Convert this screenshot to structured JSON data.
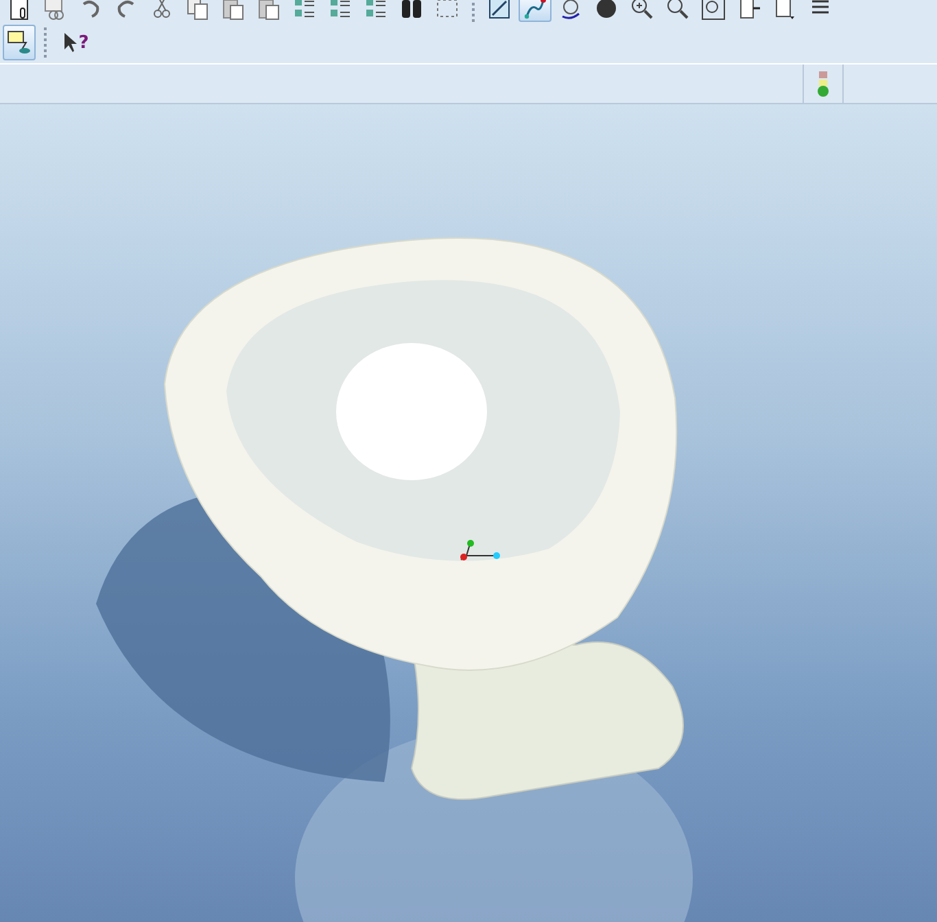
{
  "toolbar_top": [
    {
      "kind": "new",
      "selected": false
    },
    {
      "kind": "link",
      "selected": false
    },
    {
      "kind": "undo",
      "selected": false
    },
    {
      "kind": "redo",
      "selected": false
    },
    {
      "kind": "cut",
      "selected": false
    },
    {
      "kind": "copy",
      "selected": false
    },
    {
      "kind": "paste",
      "selected": false
    },
    {
      "kind": "paste",
      "selected": false
    },
    {
      "kind": "list",
      "selected": false
    },
    {
      "kind": "list",
      "selected": false
    },
    {
      "kind": "list",
      "selected": false
    },
    {
      "kind": "binoculars",
      "selected": false
    },
    {
      "kind": "selectbox",
      "selected": false
    },
    {
      "kind": "sep"
    },
    {
      "kind": "sketch",
      "selected": false
    },
    {
      "kind": "curve",
      "selected": true
    },
    {
      "kind": "spin",
      "selected": false
    },
    {
      "kind": "sphere",
      "selected": false
    },
    {
      "kind": "zoomin",
      "selected": false
    },
    {
      "kind": "zoomout",
      "selected": false
    },
    {
      "kind": "fit",
      "selected": false
    },
    {
      "kind": "view",
      "selected": false
    },
    {
      "kind": "page",
      "selected": false
    },
    {
      "kind": "layers",
      "selected": false
    }
  ],
  "toolbar_second": [
    {
      "kind": "filter",
      "selected": true
    },
    {
      "kind": "sep"
    },
    {
      "kind": "help",
      "selected": false,
      "label": "?"
    }
  ],
  "status_strip": {
    "regenerated": true
  }
}
